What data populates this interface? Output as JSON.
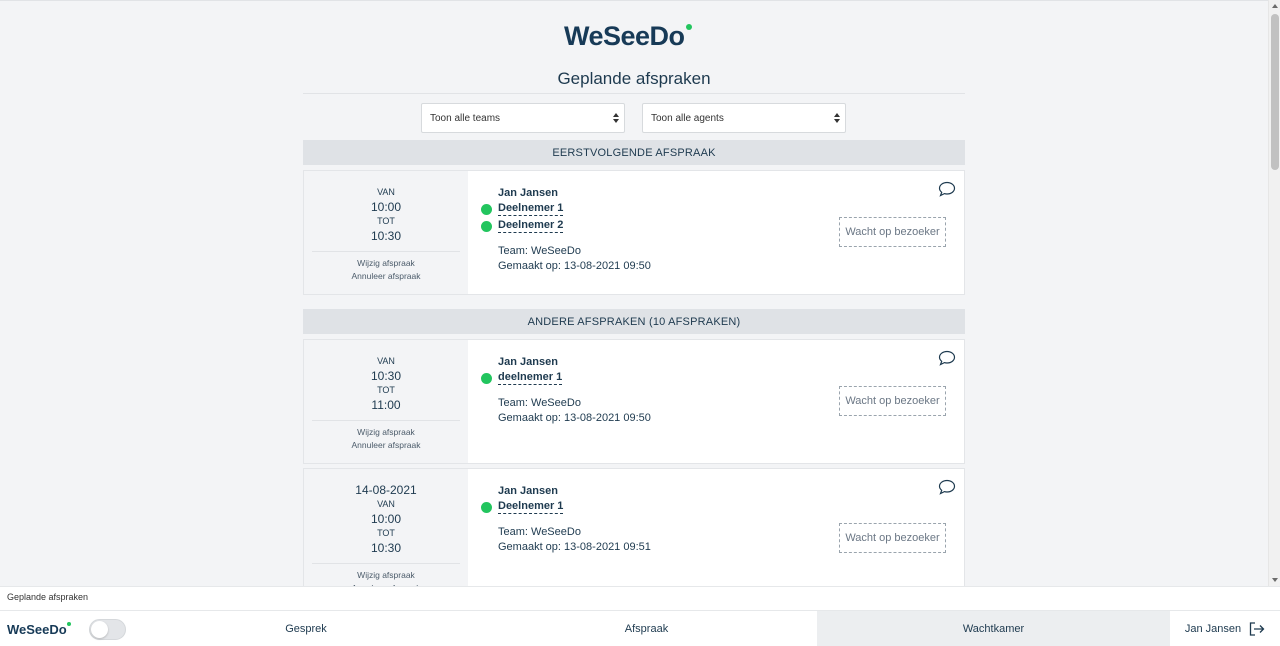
{
  "header": {
    "logo": "WeSeeDo",
    "page_title": "Geplande afspraken"
  },
  "filters": {
    "teams": "Toon alle teams",
    "agents": "Toon alle agents"
  },
  "sections": {
    "next": "EERSTVOLGENDE AFSPRAAK",
    "other": "ANDERE AFSPRAKEN (10 AFSPRAKEN)"
  },
  "labels": {
    "van": "VAN",
    "tot": "TOT",
    "edit": "Wijzig afspraak",
    "cancel": "Annuleer afspraak",
    "wait_button": "Wacht op bezoeker"
  },
  "appointments": [
    {
      "date": "",
      "from": "10:00",
      "to": "10:30",
      "host": "Jan Jansen",
      "participants": [
        "Deelnemer 1",
        "Deelnemer 2"
      ],
      "team": "Team: WeSeeDo",
      "created": "Gemaakt op: 13-08-2021 09:50"
    },
    {
      "date": "",
      "from": "10:30",
      "to": "11:00",
      "host": "Jan Jansen",
      "participants": [
        "deelnemer 1"
      ],
      "team": "Team: WeSeeDo",
      "created": "Gemaakt op: 13-08-2021 09:50"
    },
    {
      "date": "14-08-2021",
      "from": "10:00",
      "to": "10:30",
      "host": "Jan Jansen",
      "participants": [
        "Deelnemer 1"
      ],
      "team": "Team: WeSeeDo",
      "created": "Gemaakt op: 13-08-2021 09:51"
    }
  ],
  "footer": {
    "caption": "Geplande afspraken",
    "logo": "WeSeeDo",
    "nav": [
      "Gesprek",
      "Afspraak",
      "Wachtkamer"
    ],
    "active_nav": "Wachtkamer",
    "user": "Jan Jansen"
  },
  "colors": {
    "brand": "#173a57",
    "online": "#22c55e",
    "background": "#f3f4f6"
  }
}
